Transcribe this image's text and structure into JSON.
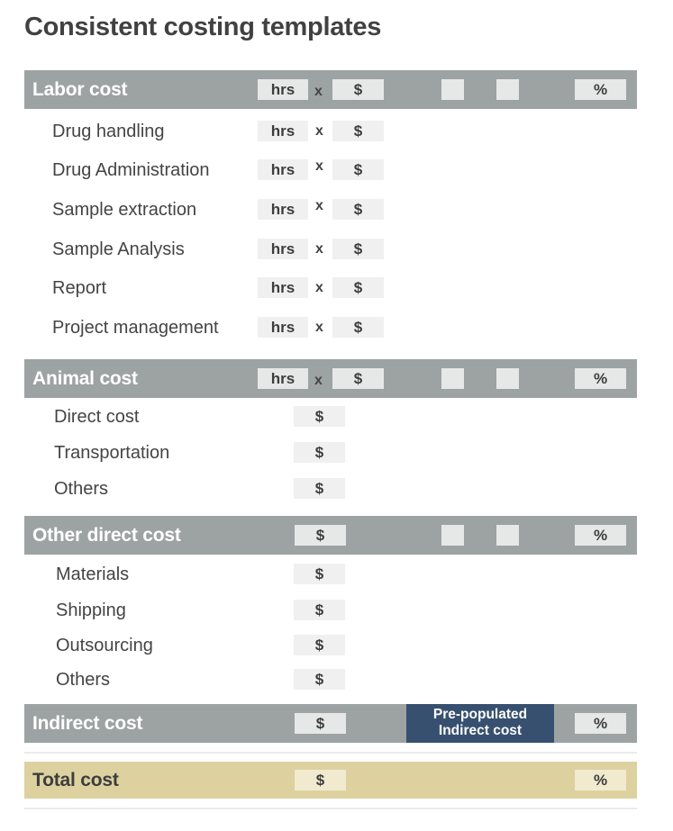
{
  "title": "Consistent costing templates",
  "symbols": {
    "hours": "hrs",
    "times": "x",
    "dollar": "$",
    "percent": "%"
  },
  "sections": {
    "labor": {
      "label": "Labor cost",
      "items": [
        "Drug handling",
        "Drug Administration",
        "Sample extraction",
        "Sample Analysis",
        "Report",
        "Project management"
      ]
    },
    "animal": {
      "label": "Animal cost",
      "items": [
        "Direct cost",
        "Transportation",
        "Others"
      ]
    },
    "other_direct": {
      "label": "Other direct cost",
      "items": [
        "Materials",
        "Shipping",
        "Outsourcing",
        "Others"
      ]
    },
    "indirect": {
      "label": "Indirect cost",
      "prepopulated_line1": "Pre-populated",
      "prepopulated_line2": "Indirect cost"
    },
    "total": {
      "label": "Total cost"
    }
  },
  "colors": {
    "header_bar": "#9da3a2",
    "total_bar": "#ddd1a0",
    "prepopulated_box": "#37506f",
    "field_box": "#e6e8e7"
  }
}
